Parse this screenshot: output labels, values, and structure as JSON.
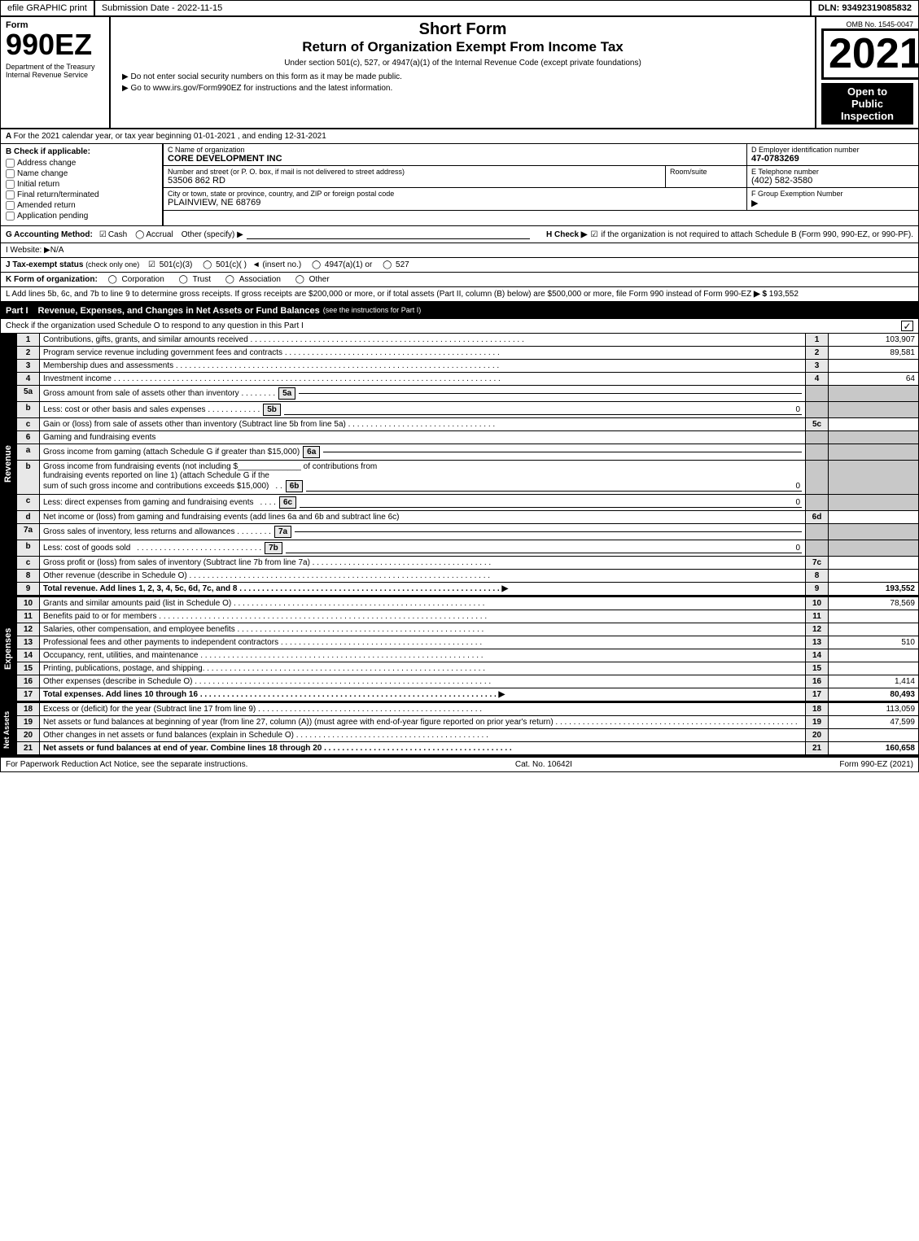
{
  "header": {
    "efile_label": "efile GRAPHIC print",
    "submission_date_label": "Submission Date - 2022-11-15",
    "dln_label": "DLN: 93492319085832"
  },
  "form_header": {
    "form_label": "Form",
    "form_number": "990EZ",
    "dept_label": "Department of the Treasury",
    "irs_label": "Internal Revenue Service",
    "omb_label": "OMB No. 1545-0047",
    "title_short": "Short Form",
    "title_main": "Return of Organization Exempt From Income Tax",
    "subtitle": "Under section 501(c), 527, or 4947(a)(1) of the Internal Revenue Code (except private foundations)",
    "instruction1": "▶ Do not enter social security numbers on this form as it may be made public.",
    "instruction2": "▶ Go to www.irs.gov/Form990EZ for instructions and the latest information.",
    "year": "2021",
    "open_line1": "Open to",
    "open_line2": "Public",
    "open_line3": "Inspection"
  },
  "section_a": {
    "label": "A",
    "calendar_year": "For the 2021 calendar year, or tax year beginning 01-01-2021 , and ending 12-31-2021",
    "b_label": "B  Check if applicable:",
    "checkboxes": {
      "address_change": "Address change",
      "name_change": "Name change",
      "initial_return": "Initial return",
      "final_return": "Final return/terminated",
      "amended_return": "Amended return",
      "application_pending": "Application pending"
    },
    "c_label": "C Name of organization",
    "org_name": "CORE DEVELOPMENT INC",
    "d_label": "D Employer identification number",
    "ein": "47-0783269",
    "address_label": "Number and street (or P. O. box, if mail is not delivered to street address)",
    "address": "53506 862 RD",
    "room_label": "Room/suite",
    "phone_label": "E Telephone number",
    "phone": "(402) 582-3580",
    "city_label": "City or town, state or province, country, and ZIP or foreign postal code",
    "city": "PLAINVIEW, NE  68769",
    "f_label": "F Group Exemption Number",
    "f_arrow": "▶"
  },
  "accounting": {
    "g_label": "G Accounting Method:",
    "cash_checked": true,
    "cash_label": "Cash",
    "accrual_label": "Accrual",
    "other_label": "Other (specify) ▶",
    "h_label": "H  Check ▶",
    "h_checked": true,
    "h_text": "if the organization is not required to attach Schedule B (Form 990, 990-EZ, or 990-PF)."
  },
  "website": {
    "i_label": "I Website: ▶N/A"
  },
  "tax_status": {
    "j_label": "J Tax-exempt status",
    "j_note": "(check only one)",
    "status_501c3_checked": true,
    "status_501c3": "501(c)(3)",
    "status_501c": "501(c)(  )",
    "insert_label": "◄ (insert no.)",
    "status_4947": "4947(a)(1) or",
    "status_527": "527"
  },
  "k_row": {
    "label": "K Form of organization:",
    "corporation": "Corporation",
    "trust": "Trust",
    "association": "Association",
    "other": "Other"
  },
  "l_row": {
    "text": "L Add lines 5b, 6c, and 7b to line 9 to determine gross receipts. If gross receipts are $200,000 or more, or if total assets (Part II, column (B) below) are $500,000 or more, file Form 990 instead of Form 990-EZ",
    "arrow": "▶ $",
    "amount": "193,552"
  },
  "part1": {
    "label": "Part I",
    "title": "Revenue, Expenses, and Changes in Net Assets or Fund Balances",
    "see_instructions": "(see the instructions for Part I)",
    "check_text": "Check if the organization used Schedule O to respond to any question in this Part I",
    "lines": [
      {
        "num": "1",
        "desc": "Contributions, gifts, grants, and similar amounts received",
        "col": "1",
        "amount": "103,907"
      },
      {
        "num": "2",
        "desc": "Program service revenue including government fees and contracts",
        "col": "2",
        "amount": "89,581"
      },
      {
        "num": "3",
        "desc": "Membership dues and assessments",
        "col": "3",
        "amount": ""
      },
      {
        "num": "4",
        "desc": "Investment income",
        "col": "4",
        "amount": "64"
      },
      {
        "num": "5a",
        "desc": "Gross amount from sale of assets other than inventory",
        "inner_col": "5a",
        "inner_val": "",
        "col": "",
        "amount": ""
      },
      {
        "num": "b",
        "desc": "Less: cost or other basis and sales expenses",
        "inner_col": "5b",
        "inner_val": "0",
        "col": "",
        "amount": ""
      },
      {
        "num": "c",
        "desc": "Gain or (loss) from sale of assets other than inventory (Subtract line 5b from line 5a)",
        "col": "5c",
        "amount": ""
      },
      {
        "num": "6",
        "desc": "Gaming and fundraising events",
        "col": "",
        "amount": ""
      },
      {
        "num": "a",
        "desc": "Gross income from gaming (attach Schedule G if greater than $15,000)",
        "inner_col": "6a",
        "inner_val": "",
        "col": "",
        "amount": ""
      },
      {
        "num": "b",
        "desc": "Gross income from fundraising events (not including $_____ of contributions from fundraising events reported on line 1) (attach Schedule G if the sum of such gross income and contributions exceeds $15,000)",
        "inner_col": "6b",
        "inner_val": "0",
        "col": "",
        "amount": ""
      },
      {
        "num": "c",
        "desc": "Less: direct expenses from gaming and fundraising events",
        "inner_col": "6c",
        "inner_val": "0",
        "col": "",
        "amount": ""
      },
      {
        "num": "d",
        "desc": "Net income or (loss) from gaming and fundraising events (add lines 6a and 6b and subtract line 6c)",
        "col": "6d",
        "amount": ""
      },
      {
        "num": "7a",
        "desc": "Gross sales of inventory, less returns and allowances",
        "inner_col": "7a",
        "inner_val": "",
        "col": "",
        "amount": ""
      },
      {
        "num": "b",
        "desc": "Less: cost of goods sold",
        "inner_col": "7b",
        "inner_val": "0",
        "col": "",
        "amount": ""
      },
      {
        "num": "c",
        "desc": "Gross profit or (loss) from sales of inventory (Subtract line 7b from line 7a)",
        "col": "7c",
        "amount": ""
      },
      {
        "num": "8",
        "desc": "Other revenue (describe in Schedule O)",
        "col": "8",
        "amount": ""
      },
      {
        "num": "9",
        "desc": "Total revenue. Add lines 1, 2, 3, 4, 5c, 6d, 7c, and 8",
        "arrow": "▶",
        "col": "9",
        "amount": "193,552",
        "bold": true
      }
    ]
  },
  "expenses": {
    "lines": [
      {
        "num": "10",
        "desc": "Grants and similar amounts paid (list in Schedule O)",
        "col": "10",
        "amount": "78,569"
      },
      {
        "num": "11",
        "desc": "Benefits paid to or for members",
        "col": "11",
        "amount": ""
      },
      {
        "num": "12",
        "desc": "Salaries, other compensation, and employee benefits",
        "col": "12",
        "amount": ""
      },
      {
        "num": "13",
        "desc": "Professional fees and other payments to independent contractors",
        "col": "13",
        "amount": "510"
      },
      {
        "num": "14",
        "desc": "Occupancy, rent, utilities, and maintenance",
        "col": "14",
        "amount": ""
      },
      {
        "num": "15",
        "desc": "Printing, publications, postage, and shipping",
        "col": "15",
        "amount": ""
      },
      {
        "num": "16",
        "desc": "Other expenses (describe in Schedule O)",
        "col": "16",
        "amount": "1,414"
      },
      {
        "num": "17",
        "desc": "Total expenses. Add lines 10 through 16",
        "arrow": "▶",
        "col": "17",
        "amount": "80,493",
        "bold": true
      }
    ]
  },
  "net_assets": {
    "lines": [
      {
        "num": "18",
        "desc": "Excess or (deficit) for the year (Subtract line 17 from line 9)",
        "col": "18",
        "amount": "113,059"
      },
      {
        "num": "19",
        "desc": "Net assets or fund balances at beginning of year (from line 27, column (A)) (must agree with end-of-year figure reported on prior year's return)",
        "col": "19",
        "amount": "47,599"
      },
      {
        "num": "20",
        "desc": "Other changes in net assets or fund balances (explain in Schedule O)",
        "col": "20",
        "amount": ""
      },
      {
        "num": "21",
        "desc": "Net assets or fund balances at end of year. Combine lines 18 through 20",
        "col": "21",
        "amount": "160,658"
      }
    ]
  },
  "footer": {
    "paperwork_text": "For Paperwork Reduction Act Notice, see the separate instructions.",
    "cat_no": "Cat. No. 10642I",
    "form_label": "Form 990-EZ (2021)"
  }
}
